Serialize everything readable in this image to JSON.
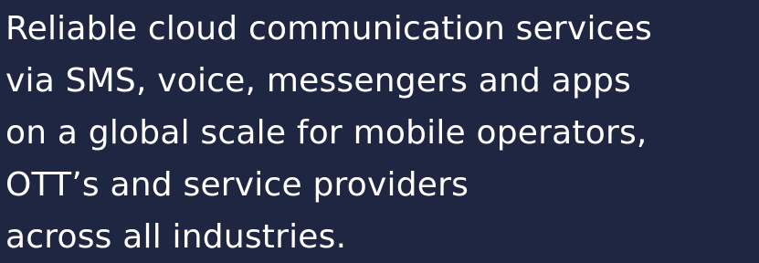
{
  "hero": {
    "lines": [
      "Reliable cloud communication services",
      "via SMS, voice, messengers and apps",
      "on a global scale for mobile operators,",
      "OTT’s and service providers",
      "across all industries."
    ]
  },
  "colors": {
    "background": "#1e2642",
    "text": "#ffffff"
  }
}
